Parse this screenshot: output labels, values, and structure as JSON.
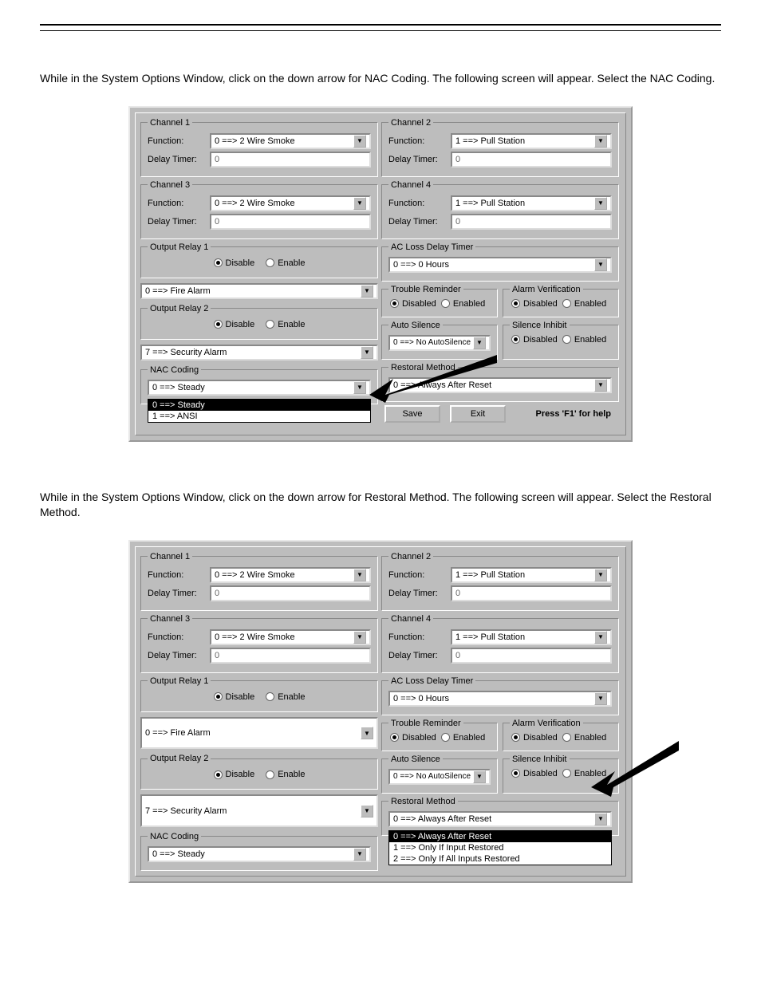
{
  "section1_text": "While in the System Options Window, click on the down arrow for NAC Coding. The following screen will appear. Select the NAC Coding.",
  "section2_text": "While in the System Options Window, click on the down arrow for Restoral Method. The following screen will appear. Select the Restoral Method.",
  "labels": {
    "function": "Function:",
    "delay_timer": "Delay Timer:",
    "disable": "Disable",
    "enable": "Enable",
    "disabled": "Disabled",
    "enabled": "Enabled",
    "save": "Save",
    "exit": "Exit",
    "help": "Press 'F1' for help"
  },
  "legends": {
    "ch1": "Channel 1",
    "ch2": "Channel 2",
    "ch3": "Channel 3",
    "ch4": "Channel 4",
    "out1": "Output Relay 1",
    "out2": "Output Relay 2",
    "nac": "NAC Coding",
    "aclost": "AC Loss Delay Timer",
    "trouble": "Trouble Reminder",
    "alarmver": "Alarm Verification",
    "autosilence": "Auto Silence",
    "silenceinhib": "Silence Inhibit",
    "restoral": "Restoral Method"
  },
  "values": {
    "ch_smoke": "0  ==> 2 Wire Smoke",
    "ch_pull": "1  ==> Pull Station",
    "delay_zero": "0",
    "fire_alarm": "0 ==> Fire Alarm",
    "security_alarm": "7 ==> Security Alarm",
    "nac_steady": "0 ==> Steady",
    "ac_hours": "0 ==> 0 Hours",
    "no_autosilence": "0 ==> No AutoSilence",
    "always_reset": "0 ==> Always After Reset"
  },
  "nac_dropdown": {
    "opt0": "0 ==> Steady",
    "opt1": "1 ==> ANSI"
  },
  "restoral_dropdown": {
    "opt0": "0 ==> Always After Reset",
    "opt1": "1 ==> Only If Input Restored",
    "opt2": "2 ==> Only If All Inputs Restored"
  }
}
